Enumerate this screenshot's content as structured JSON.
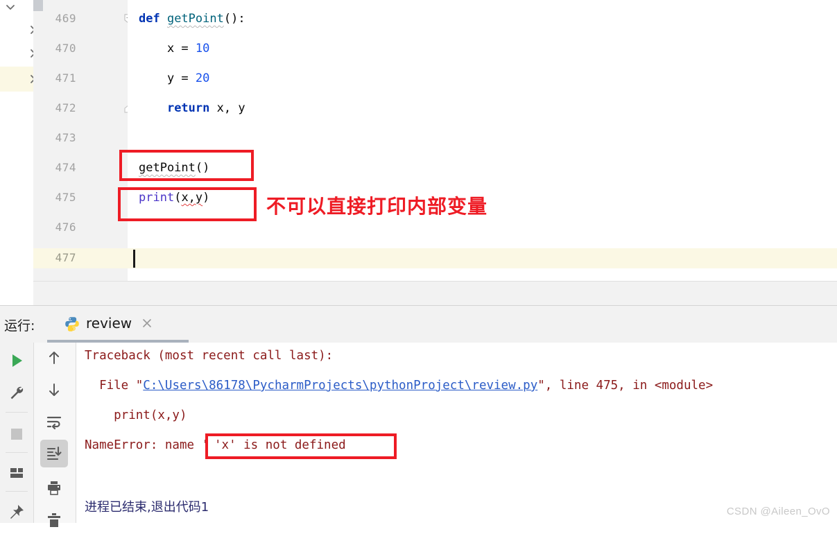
{
  "editor": {
    "line_numbers": [
      "469",
      "470",
      "471",
      "472",
      "473",
      "474",
      "475",
      "476",
      "477"
    ],
    "current_line": "477",
    "lines": [
      {
        "n": "469",
        "tokens": [
          {
            "t": "def ",
            "c": "kw"
          },
          {
            "t": "getPoint",
            "c": "fname wavy-gray"
          },
          {
            "t": "():",
            "c": "plain"
          }
        ]
      },
      {
        "n": "470",
        "tokens": [
          {
            "t": "    x = ",
            "c": "plain"
          },
          {
            "t": "10",
            "c": "num"
          }
        ]
      },
      {
        "n": "471",
        "tokens": [
          {
            "t": "    y = ",
            "c": "plain"
          },
          {
            "t": "20",
            "c": "num"
          }
        ]
      },
      {
        "n": "472",
        "tokens": [
          {
            "t": "    ",
            "c": "plain"
          },
          {
            "t": "return",
            "c": "kw"
          },
          {
            "t": " x, y",
            "c": "plain"
          }
        ]
      },
      {
        "n": "473",
        "tokens": []
      },
      {
        "n": "474",
        "tokens": [
          {
            "t": "getPoint",
            "c": "fcall wavy-gray"
          },
          {
            "t": "()",
            "c": "plain"
          }
        ]
      },
      {
        "n": "475",
        "tokens": [
          {
            "t": "print",
            "c": "builtin"
          },
          {
            "t": "(",
            "c": "plain"
          },
          {
            "t": "x,y",
            "c": "plain wavy-red"
          },
          {
            "t": ")",
            "c": "plain"
          }
        ]
      },
      {
        "n": "476",
        "tokens": []
      },
      {
        "n": "477",
        "tokens": []
      }
    ],
    "annotation_text": "不可以直接打印内部变量",
    "annotation_color": "#ee1c25",
    "fold_icons": [
      "fold-collapse-icon",
      "fold-end-icon"
    ],
    "structure_chevrons": [
      "chevron-down-icon",
      "chevron-right-icon",
      "chevron-right-icon",
      "chevron-right-icon"
    ]
  },
  "run_panel": {
    "title": "运行:",
    "tab_label": "review",
    "tab_icon": "python-file-icon",
    "close_icon": "close-icon",
    "toolbar_primary": [
      {
        "name": "rerun-button",
        "icon": "play-icon",
        "color": "#3aa856"
      },
      {
        "name": "run-settings-button",
        "icon": "wrench-icon",
        "color": "#5a5a5a"
      },
      {
        "name": "stop-button",
        "icon": "stop-square-icon",
        "color": "#c4c4c4"
      },
      {
        "name": "layout-button",
        "icon": "windows-layout-icon",
        "color": "#5a5a5a"
      },
      {
        "name": "pin-tab-button",
        "icon": "pin-icon",
        "color": "#5a5a5a"
      }
    ],
    "toolbar_secondary": [
      {
        "name": "prev-occurrence-button",
        "icon": "arrow-up-icon",
        "color": "#5a5a5a"
      },
      {
        "name": "next-occurrence-button",
        "icon": "arrow-down-icon",
        "color": "#5a5a5a"
      },
      {
        "name": "soft-wrap-button",
        "icon": "soft-wrap-icon",
        "color": "#5a5a5a"
      },
      {
        "name": "scroll-to-end-button",
        "icon": "scroll-to-end-icon",
        "color": "#5a5a5a",
        "active": true
      },
      {
        "name": "print-button",
        "icon": "printer-icon",
        "color": "#5a5a5a"
      },
      {
        "name": "clear-all-button",
        "icon": "trash-icon",
        "color": "#5a5a5a"
      }
    ],
    "console": {
      "traceback_header": "Traceback (most recent call last):",
      "file_prefix": "  File \"",
      "file_link": "C:\\Users\\86178\\PycharmProjects\\pythonProject\\review.py",
      "file_suffix": "\", line 475, in <module>",
      "code_line": "    print(x,y)",
      "error_prefix": "NameError: name ",
      "error_boxed": "'x' is not defined",
      "exit_line": "进程已结束,退出代码1",
      "exit_color": "#2b2b6e",
      "error_color": "#8b1a1a",
      "link_color": "#2b5cc7"
    }
  },
  "watermark": "CSDN @Aileen_OvO"
}
